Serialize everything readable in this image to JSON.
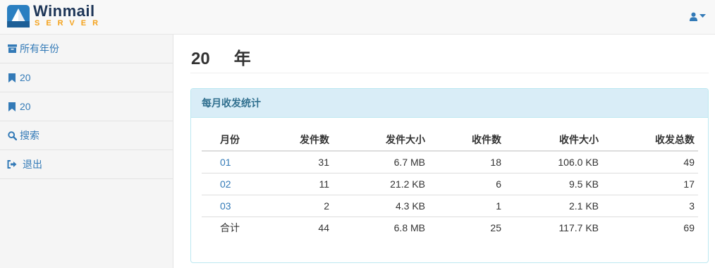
{
  "brand": {
    "name": "Winmail",
    "subtitle": "SERVER"
  },
  "header": {
    "user_menu_icon": "user-icon",
    "caret_icon": "caret-down-icon"
  },
  "sidebar": {
    "items": [
      {
        "icon": "archive-icon",
        "label": "所有年份"
      },
      {
        "icon": "bookmark-icon",
        "label": "20"
      },
      {
        "icon": "bookmark-icon",
        "label": "20"
      },
      {
        "icon": "search-icon",
        "label": "搜索"
      },
      {
        "icon": "sign-out-icon",
        "label": "退出"
      }
    ]
  },
  "main": {
    "title_year": "20",
    "title_suffix": "年",
    "panel_title": "每月收发统计",
    "table": {
      "headers": [
        "月份",
        "发件数",
        "发件大小",
        "收件数",
        "收件大小",
        "收发总数"
      ],
      "rows": [
        [
          "01",
          "31",
          "6.7 MB",
          "18",
          "106.0 KB",
          "49"
        ],
        [
          "02",
          "11",
          "21.2 KB",
          "6",
          "9.5 KB",
          "17"
        ],
        [
          "03",
          "2",
          "4.3 KB",
          "1",
          "2.1 KB",
          "3"
        ]
      ],
      "total": [
        "合计",
        "44",
        "6.8 MB",
        "25",
        "117.7 KB",
        "69"
      ]
    }
  },
  "colors": {
    "link": "#337ab7",
    "panel_heading_bg": "#d9edf7",
    "panel_heading_text": "#31708f",
    "brand_orange": "#f4a21c"
  }
}
